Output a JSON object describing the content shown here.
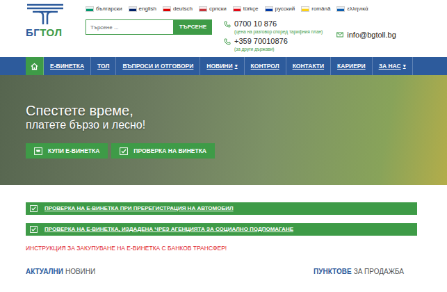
{
  "logo": {
    "first": "БГ",
    "second": "ТОЛ"
  },
  "languages": [
    {
      "label": "български",
      "color": "#00966e"
    },
    {
      "label": "english",
      "color": "#012169"
    },
    {
      "label": "deutsch",
      "color": "#dd0000"
    },
    {
      "label": "српски",
      "color": "#c6363c"
    },
    {
      "label": "türkçe",
      "color": "#e30a17"
    },
    {
      "label": "русский",
      "color": "#0039a6"
    },
    {
      "label": "română",
      "color": "#fcd116"
    },
    {
      "label": "ελληνικά",
      "color": "#0d5eaf"
    }
  ],
  "search": {
    "placeholder": "Търсене ...",
    "button": "ТЪРСЕНЕ"
  },
  "phones": [
    {
      "number": "0700 10 876",
      "note": "(цена на разговор според тарифния план)"
    },
    {
      "number": "+359 70010876",
      "note": "(за други държави)"
    }
  ],
  "email": "info@bgtoll.bg",
  "nav": [
    {
      "kind": "home",
      "selected": true
    },
    {
      "kind": "link",
      "label": "Е-ВИНЕТКА",
      "selected": false,
      "has_menu": false
    },
    {
      "kind": "link",
      "label": "ТОЛ",
      "selected": false,
      "has_menu": false
    },
    {
      "kind": "link",
      "label": "ВЪПРОСИ И ОТГОВОРИ",
      "selected": false,
      "has_menu": false
    },
    {
      "kind": "link",
      "label": "НОВИНИ",
      "selected": false,
      "has_menu": true
    },
    {
      "kind": "link",
      "label": "КОНТРОЛ",
      "selected": false,
      "has_menu": false
    },
    {
      "kind": "link",
      "label": "КОНТАКТИ",
      "selected": false,
      "has_menu": false
    },
    {
      "kind": "link",
      "label": "КАРИЕРИ",
      "selected": false,
      "has_menu": false
    },
    {
      "kind": "link",
      "label": "ЗА НАС",
      "selected": false,
      "has_menu": true
    }
  ],
  "hero": {
    "title": "Спестете време,",
    "subtitle": "платете бързо и лесно!",
    "buttons": [
      {
        "label": "КУПИ Е-ВИНЕТКА",
        "kind": "buy"
      },
      {
        "label": "ПРОВЕРКА НА ВИНЕТКА",
        "kind": "check"
      }
    ]
  },
  "checks": [
    "ПРОВЕРКА НА Е-ВИНЕТКА ПРИ ПРЕРЕГИСТРАЦИЯ НА АВТОМОБИЛ",
    "ПРОВЕРКА НА Е-ВИНЕТКА, ИЗДАДЕНА ЧРЕЗ АГЕНЦИЯТА ЗА СОЦИАЛНО ПОДПОМАГАНЕ"
  ],
  "notice": "ИНСТРУКЦИЯ ЗА ЗАКУПУВАНЕ НА Е-ВИНЕТКА С БАНКОВ ТРАНСФЕР!",
  "sections": [
    {
      "strong": "АКТУАЛНИ",
      "rest": "НОВИНИ"
    },
    {
      "strong": "ПУНКТОВЕ",
      "rest": "ЗА ПРОДАЖБА"
    }
  ]
}
